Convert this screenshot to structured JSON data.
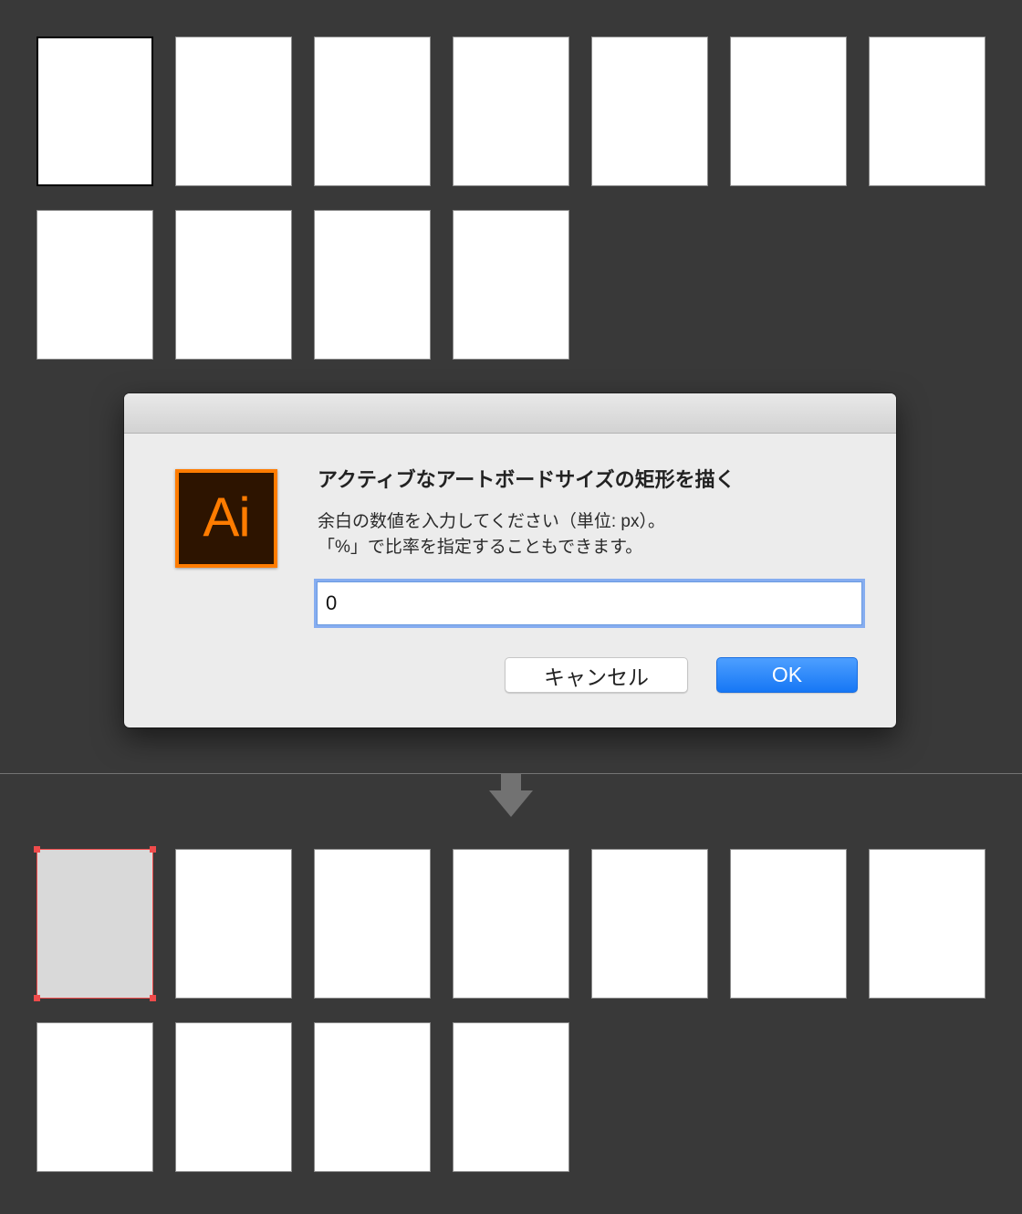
{
  "dialog": {
    "icon_label": "Ai",
    "title": "アクティブなアートボードサイズの矩形を描く",
    "message_lines": [
      "余白の数値を入力してください（単位: px）。",
      "「%」で比率を指定することもできます。"
    ],
    "margin_input": {
      "value": "0"
    },
    "buttons": {
      "cancel": "キャンセル",
      "ok": "OK"
    }
  },
  "icons": {
    "app": "adobe-illustrator-icon",
    "arrow": "arrow-down-icon"
  },
  "colors": {
    "selection": "#ef4b4b",
    "accent": "#1677f5",
    "brand_orange": "#ff7c00",
    "brand_dark": "#2d1400"
  }
}
